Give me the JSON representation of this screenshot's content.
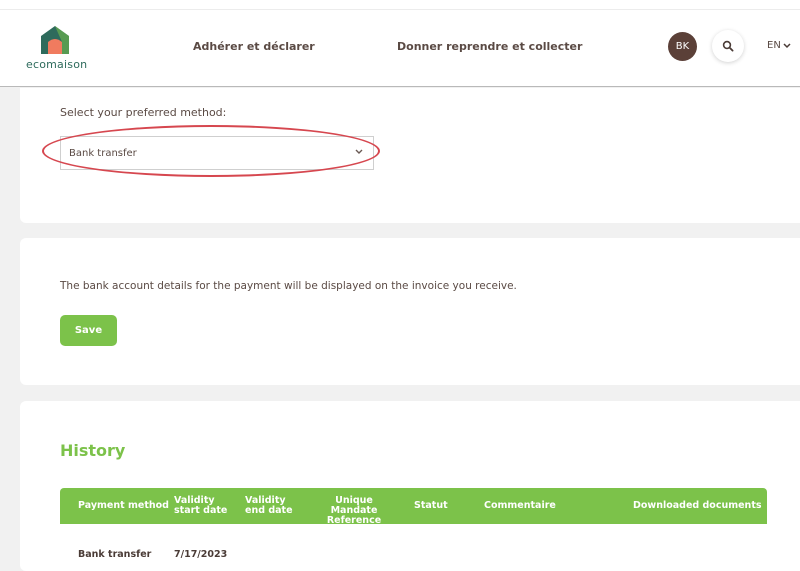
{
  "brand": {
    "name": "ecomaison",
    "accent": "#7cc24a",
    "dark": "#5b4038",
    "annotation": "#d6474f"
  },
  "nav": {
    "adherer": "Adhérer et déclarer",
    "donner": "Donner reprendre et collecter",
    "avatar_initials": "BK",
    "search_icon": "search-icon",
    "language": "EN"
  },
  "method": {
    "label": "Select your preferred method:",
    "selected": "Bank transfer"
  },
  "bank": {
    "note": "The bank account details for the payment will be displayed on the invoice you receive.",
    "save_label": "Save"
  },
  "history": {
    "title": "History",
    "columns": {
      "payment_method": "Payment method",
      "validity_start": "Validity start date",
      "validity_end": "Validity end date",
      "umr": "Unique Mandate Reference",
      "statut": "Statut",
      "commentaire": "Commentaire",
      "documents": "Downloaded documents"
    },
    "rows": [
      {
        "payment_method": "Bank transfer",
        "validity_start": "7/17/2023"
      }
    ]
  }
}
